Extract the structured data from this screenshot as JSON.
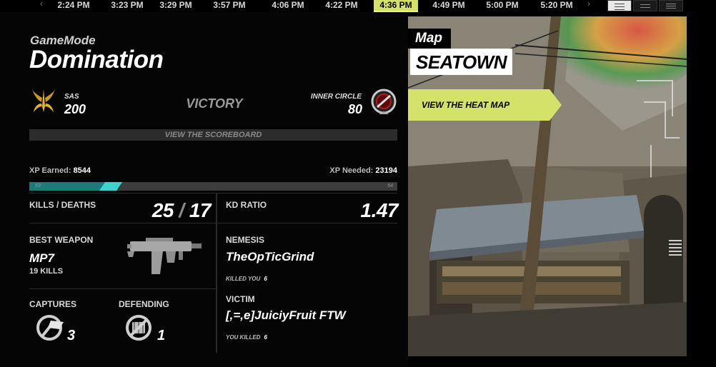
{
  "timeline": {
    "times": [
      "2:24 PM",
      "3:23 PM",
      "3:29 PM",
      "3:57 PM",
      "4:06 PM",
      "4:22 PM",
      "4:36 PM",
      "4:49 PM",
      "5:00 PM",
      "5:20 PM"
    ],
    "active_index": 6,
    "accent_color": "#d5e26a"
  },
  "header": {
    "game_mode_label": "GameMode",
    "game_mode": "Domination"
  },
  "match": {
    "team1": {
      "name": "SAS",
      "score": "200"
    },
    "team2": {
      "name": "INNER CIRCLE",
      "score": "80"
    },
    "result": "VICTORY",
    "scoreboard_label": "VIEW THE SCOREBOARD"
  },
  "xp": {
    "earned_label": "XP Earned:",
    "earned": "8544",
    "needed_label": "XP Needed:",
    "needed": "23194",
    "level_current": "53",
    "level_next": "54",
    "progress": 0.24
  },
  "stats": {
    "kills_deaths_label": "KILLS / DEATHS",
    "kills": "25",
    "separator": "/",
    "deaths": "17",
    "kd_label": "KD RATIO",
    "kd": "1.47",
    "best_weapon_label": "BEST WEAPON",
    "weapon_name": "MP7",
    "weapon_kills": "19 KILLS",
    "nemesis_label": "NEMESIS",
    "nemesis_name": "TheOpTicGrind",
    "killed_you_label": "KILLED YOU",
    "killed_you": "6",
    "victim_label": "VICTIM",
    "victim_name": "[,=,e]JuiciyFruit FTW",
    "you_killed_label": "YOU KILLED",
    "you_killed": "6",
    "captures_label": "CAPTURES",
    "captures": "3",
    "defending_label": "DEFENDING",
    "defending": "1"
  },
  "map": {
    "label": "Map",
    "name": "SEATOWN",
    "heatmap_label": "VIEW THE HEAT MAP"
  }
}
